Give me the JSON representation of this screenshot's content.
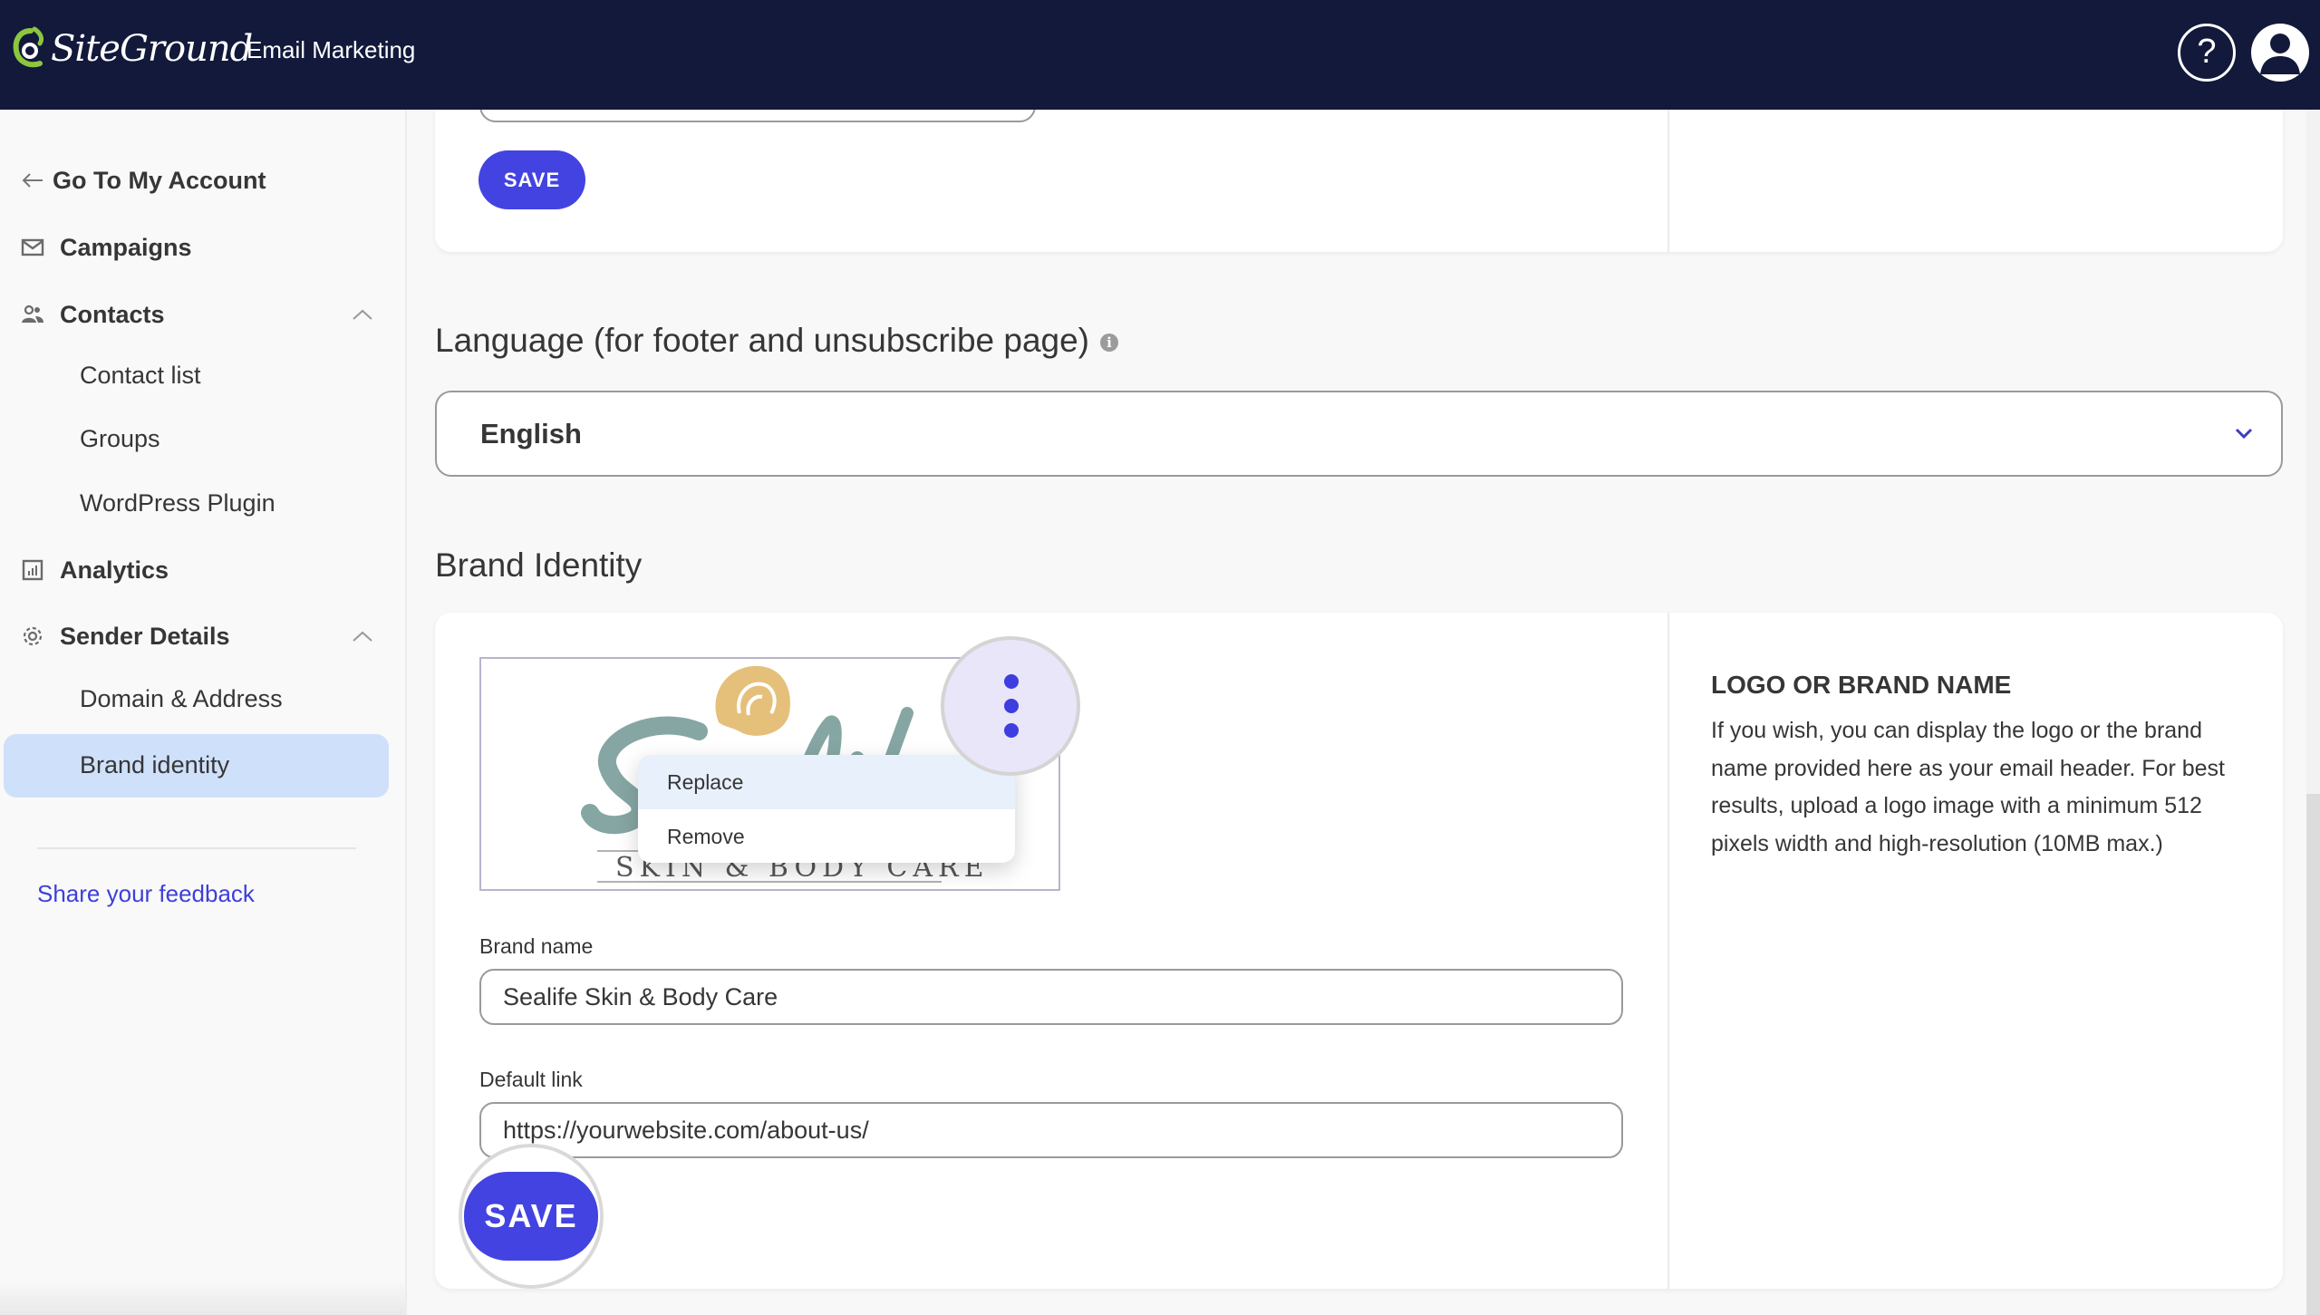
{
  "header": {
    "logo_text": "SiteGround",
    "product_name": "Email Marketing",
    "help_icon": "help-circle-icon",
    "avatar_icon": "user-avatar-icon"
  },
  "sidebar": {
    "back_label": "Go To My Account",
    "items": [
      {
        "label": "Campaigns",
        "icon": "mail-icon"
      },
      {
        "label": "Contacts",
        "icon": "contacts-icon",
        "expanded": true,
        "children": [
          "Contact list",
          "Groups",
          "WordPress Plugin"
        ]
      },
      {
        "label": "Analytics",
        "icon": "analytics-icon"
      },
      {
        "label": "Sender Details",
        "icon": "gear-icon",
        "expanded": true,
        "children": [
          "Domain & Address",
          "Brand identity"
        ]
      }
    ],
    "active_item": "Brand identity",
    "feedback_label": "Share your feedback"
  },
  "main": {
    "top_card": {
      "save_label": "SAVE"
    },
    "language": {
      "title": "Language (for footer and unsubscribe page)",
      "selected": "English"
    },
    "brand_identity": {
      "title": "Brand Identity",
      "logo_menu": [
        "Replace",
        "Remove"
      ],
      "brand_name_label": "Brand name",
      "brand_name_value": "Sealife Skin & Body Care",
      "default_link_label": "Default link",
      "default_link_value": "https://yourwebsite.com/about-us/",
      "save_label": "SAVE",
      "help_title": "LOGO OR BRAND NAME",
      "help_text": "If you wish, you can display the logo or the brand name provided here as your email header. For best results, upload a logo image with a minimum 512 pixels width and high-resolution (10MB max.)"
    }
  },
  "colors": {
    "header_bg": "#12193b",
    "accent": "#4343e2",
    "active_nav_bg": "#cfe0fa",
    "link": "#3e3fdb",
    "logo_green": "#8dc63f"
  }
}
